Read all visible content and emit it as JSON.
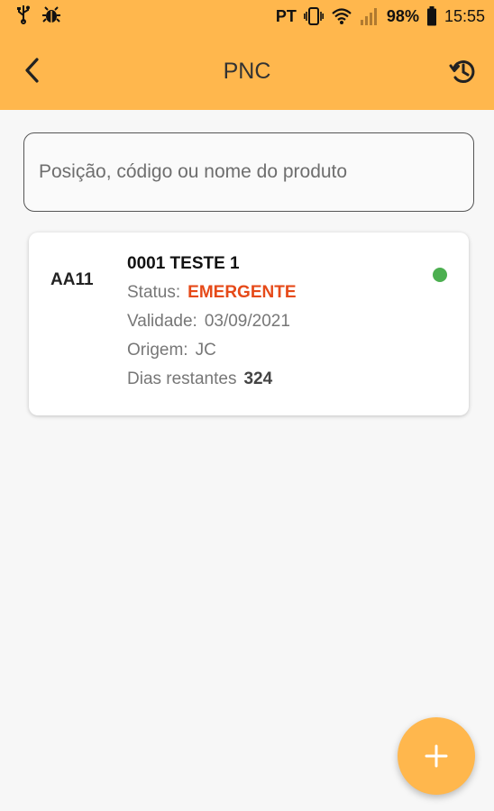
{
  "status_bar": {
    "carrier": "PT",
    "battery": "98%",
    "time": "15:55",
    "icons": [
      "usb-icon",
      "bug-icon",
      "vibrate-icon",
      "wifi-icon",
      "signal-icon",
      "battery-icon"
    ]
  },
  "app_bar": {
    "title": "PNC",
    "back_icon": "chevron-left-icon",
    "history_icon": "history-icon",
    "color": "#ffb74d"
  },
  "search": {
    "placeholder": "Posição, código ou nome do produto",
    "value": ""
  },
  "items": [
    {
      "position": "AA11",
      "name": "0001 TESTE 1",
      "status_label": "Status:",
      "status": "EMERGENTE",
      "status_color": "#e64a19",
      "validade_label": "Validade:",
      "validade": "03/09/2021",
      "origem_label": "Origem:",
      "origem": "JC",
      "dias_label": "Dias restantes",
      "dias": "324",
      "indicator_color": "#4caf50"
    }
  ],
  "fab": {
    "label": "+",
    "icon": "plus-icon"
  }
}
